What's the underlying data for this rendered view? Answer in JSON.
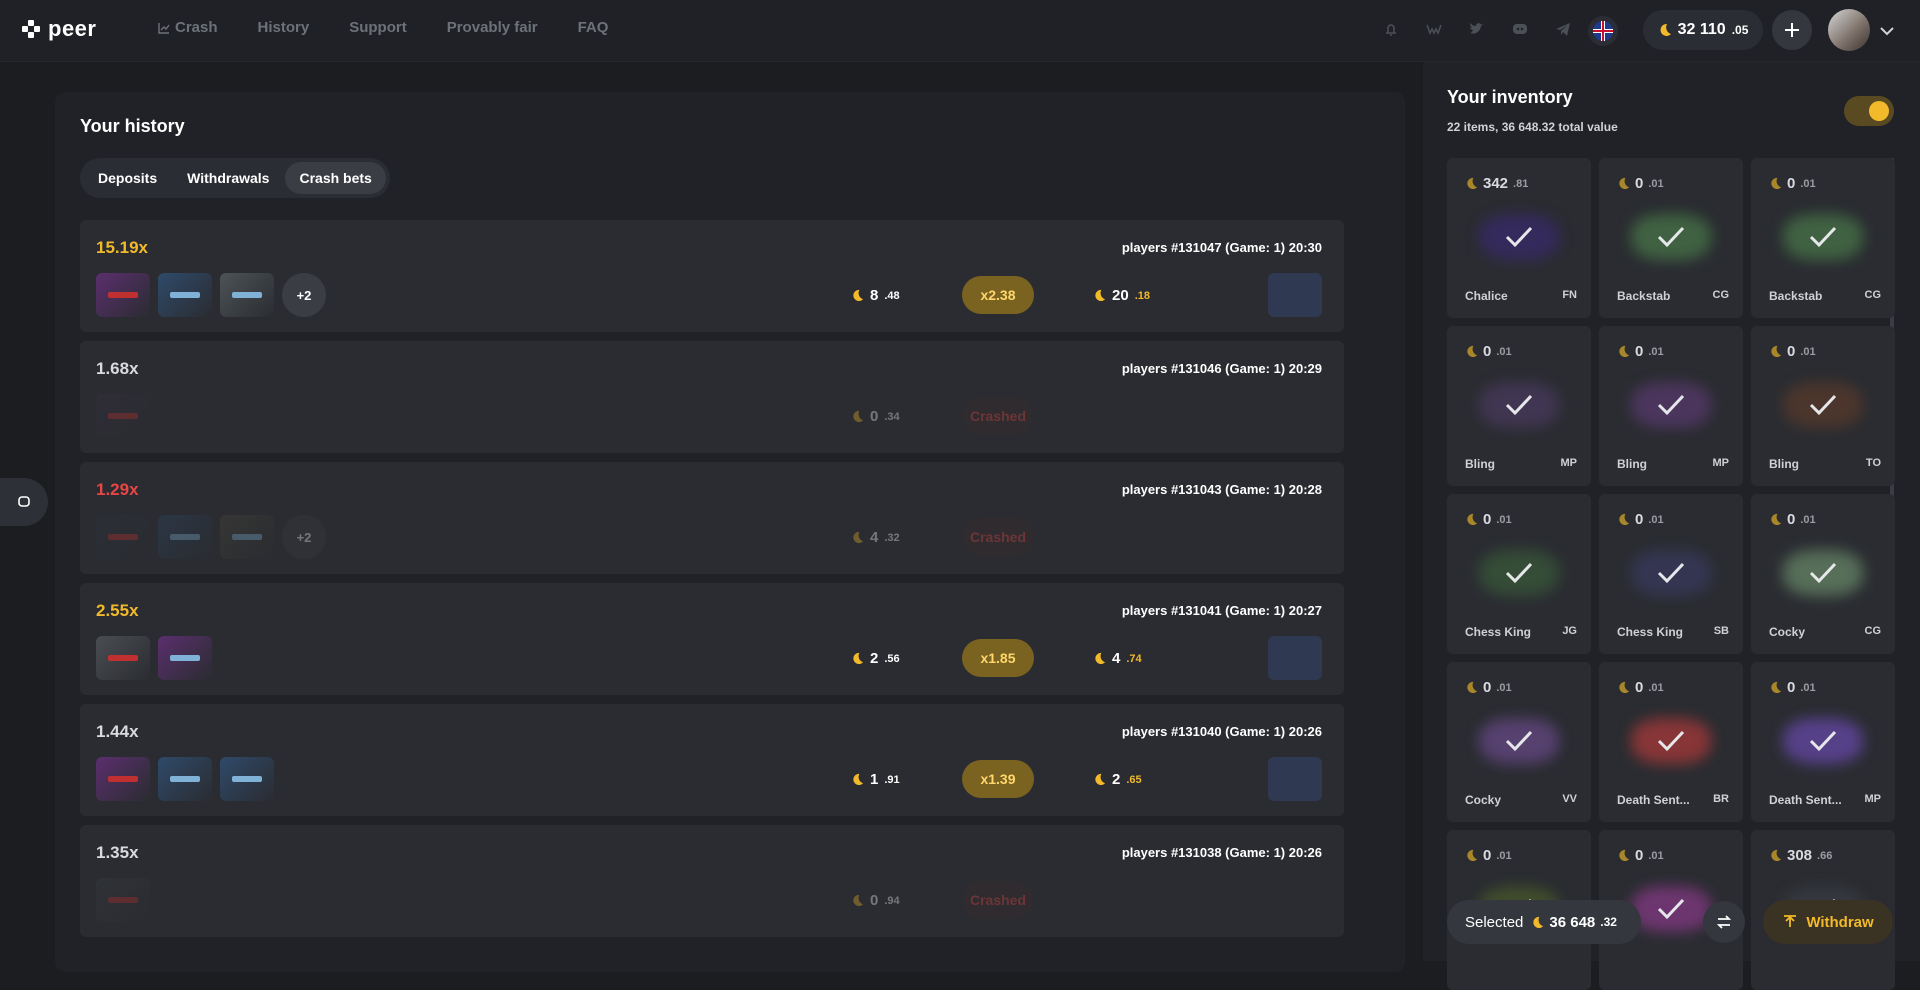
{
  "header": {
    "logo_text": "peer",
    "nav": [
      {
        "label": "Crash",
        "icon": "chart-icon"
      },
      {
        "label": "History"
      },
      {
        "label": "Support"
      },
      {
        "label": "Provably fair"
      },
      {
        "label": "FAQ"
      }
    ],
    "socials": [
      "bell-icon",
      "vk-icon",
      "twitter-icon",
      "discord-icon",
      "telegram-icon"
    ],
    "language": "uk-flag-icon",
    "balance": {
      "int": "32 110",
      "dec": ".05"
    }
  },
  "history": {
    "title": "Your history",
    "tabs": [
      "Deposits",
      "Withdrawals",
      "Crash bets"
    ],
    "active_tab": "Crash bets",
    "rows": [
      {
        "mult": "15.19x",
        "mult_color": "#f2b92a",
        "meta": "players #131047 (Game: 1)  20:30",
        "items": [
          "#5b2f6e",
          "#2f4a6a",
          "#4c5356"
        ],
        "more": "+2",
        "bet_int": "8",
        "bet_dec": ".48",
        "pill": "x2.38",
        "win_int": "20",
        "win_dec": ".18",
        "dim": false
      },
      {
        "mult": "1.68x",
        "mult_color": "#d9dadd",
        "meta": "players #131046 (Game: 1)  20:29",
        "items": [
          "#3a2f40"
        ],
        "more": "",
        "bet_int": "0",
        "bet_dec": ".34",
        "pill": "Crashed",
        "win_int": "",
        "win_dec": "",
        "dim": true
      },
      {
        "mult": "1.29x",
        "mult_color": "#e64646",
        "meta": "players #131043 (Game: 1)  20:28",
        "items": [
          "#2f3440",
          "#2f4a6a",
          "#4c4a3a"
        ],
        "more": "+2",
        "bet_int": "4",
        "bet_dec": ".32",
        "pill": "Crashed",
        "win_int": "",
        "win_dec": "",
        "dim": true
      },
      {
        "mult": "2.55x",
        "mult_color": "#f2b92a",
        "meta": "players #131041 (Game: 1)  20:27",
        "items": [
          "#4a4d52",
          "#5b2f6e"
        ],
        "more": "",
        "bet_int": "2",
        "bet_dec": ".56",
        "pill": "x1.85",
        "win_int": "4",
        "win_dec": ".74",
        "dim": false
      },
      {
        "mult": "1.44x",
        "mult_color": "#d9dadd",
        "meta": "players #131040 (Game: 1)  20:26",
        "items": [
          "#5b2f6e",
          "#2f4a6a",
          "#2f4a6a"
        ],
        "more": "",
        "bet_int": "1",
        "bet_dec": ".91",
        "pill": "x1.39",
        "win_int": "2",
        "win_dec": ".65",
        "dim": false
      },
      {
        "mult": "1.35x",
        "mult_color": "#d9dadd",
        "meta": "players #131038 (Game: 1)  20:26",
        "items": [
          "#3a3d44"
        ],
        "more": "",
        "bet_int": "0",
        "bet_dec": ".94",
        "pill": "Crashed",
        "win_int": "",
        "win_dec": "",
        "dim": true
      }
    ]
  },
  "inventory": {
    "title": "Your inventory",
    "summary": "22 items, 36 648.32 total value",
    "items": [
      {
        "int": "342",
        "dec": ".81",
        "name": "Chalice",
        "quality": "FN",
        "color": "#3a2a70"
      },
      {
        "int": "0",
        "dec": ".01",
        "name": "Backstab",
        "quality": "CG",
        "color": "#4a7a4a"
      },
      {
        "int": "0",
        "dec": ".01",
        "name": "Backstab",
        "quality": "CG",
        "color": "#4a7a4a"
      },
      {
        "int": "0",
        "dec": ".01",
        "name": "Bling",
        "quality": "MP",
        "color": "#4a3a60"
      },
      {
        "int": "0",
        "dec": ".01",
        "name": "Bling",
        "quality": "MP",
        "color": "#5a3a70"
      },
      {
        "int": "0",
        "dec": ".01",
        "name": "Bling",
        "quality": "TO",
        "color": "#5a3a2a"
      },
      {
        "int": "0",
        "dec": ".01",
        "name": "Chess King",
        "quality": "JG",
        "color": "#3a5a3a"
      },
      {
        "int": "0",
        "dec": ".01",
        "name": "Chess King",
        "quality": "SB",
        "color": "#3a3a60"
      },
      {
        "int": "0",
        "dec": ".01",
        "name": "Cocky",
        "quality": "CG",
        "color": "#6a8a6a"
      },
      {
        "int": "0",
        "dec": ".01",
        "name": "Cocky",
        "quality": "VV",
        "color": "#6a4a8a"
      },
      {
        "int": "0",
        "dec": ".01",
        "name": "Death Sent...",
        "quality": "BR",
        "color": "#b03a3a"
      },
      {
        "int": "0",
        "dec": ".01",
        "name": "Death Sent...",
        "quality": "MP",
        "color": "#6a4ab0"
      },
      {
        "int": "0",
        "dec": ".01",
        "name": "",
        "quality": "",
        "color": "#4a5a2a"
      },
      {
        "int": "0",
        "dec": ".01",
        "name": "",
        "quality": "",
        "color": "#8a3a8a"
      },
      {
        "int": "308",
        "dec": ".66",
        "name": "",
        "quality": "",
        "color": "#3a3d44"
      }
    ],
    "selected_label": "Selected",
    "selected_int": "36 648",
    "selected_dec": ".32",
    "withdraw_label": "Withdraw"
  },
  "colors": {
    "accent": "#f2b92a",
    "crashed": "#e64646",
    "bg": "#1b1d21"
  }
}
